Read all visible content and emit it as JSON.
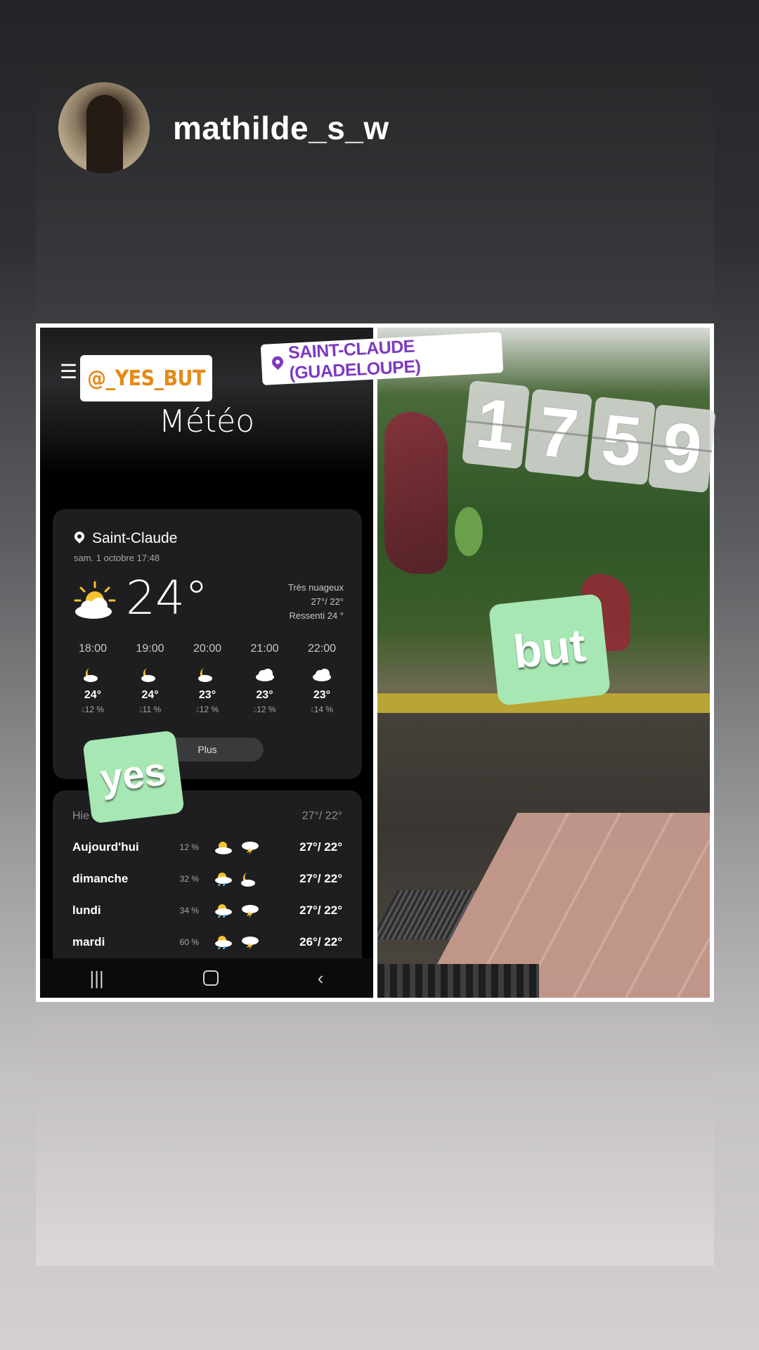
{
  "story": {
    "username": "mathilde_s_w"
  },
  "weather_app": {
    "menu_icon": "hamburger-menu-icon",
    "title": "Météo",
    "location": "Saint-Claude",
    "date": "sam. 1 octobre 17:48",
    "current_temp": "24°",
    "condition": "Très nuageux",
    "high_low": "27°/ 22°",
    "feels_like": "Ressenti 24 °",
    "hourly": [
      {
        "time": "18:00",
        "icon": "moon-partly-cloudy-icon",
        "temp": "24°",
        "precip": "12 %"
      },
      {
        "time": "19:00",
        "icon": "moon-partly-cloudy-icon",
        "temp": "24°",
        "precip": "11 %"
      },
      {
        "time": "20:00",
        "icon": "moon-partly-cloudy-icon",
        "temp": "23°",
        "precip": "12 %"
      },
      {
        "time": "21:00",
        "icon": "cloud-icon",
        "temp": "23°",
        "precip": "12 %"
      },
      {
        "time": "22:00",
        "icon": "cloud-icon",
        "temp": "23°",
        "precip": "14 %"
      }
    ],
    "plus_label": "Plus",
    "daily_header_left": "Hie",
    "daily_header_right": "27°/ 22°",
    "daily": [
      {
        "day": "Aujourd'hui",
        "precip": "12 %",
        "temps": "27°/ 22°"
      },
      {
        "day": "dimanche",
        "precip": "32 %",
        "temps": "27°/ 22°"
      },
      {
        "day": "lundi",
        "precip": "34 %",
        "temps": "27°/ 22°"
      },
      {
        "day": "mardi",
        "precip": "60 %",
        "temps": "26°/ 22°"
      }
    ],
    "nav": {
      "recent": "|||",
      "back": "‹"
    }
  },
  "stickers": {
    "mention": "@_YES_BUT",
    "location": "SAINT-CLAUDE (GUADELOUPE)",
    "clock_digits": [
      "1",
      "7",
      "5",
      "9"
    ],
    "yes": "yes",
    "but": "but"
  },
  "colors": {
    "mention": "#e48a16",
    "location": "#7d3ac1",
    "sticker_green": "#a7e7b4"
  }
}
